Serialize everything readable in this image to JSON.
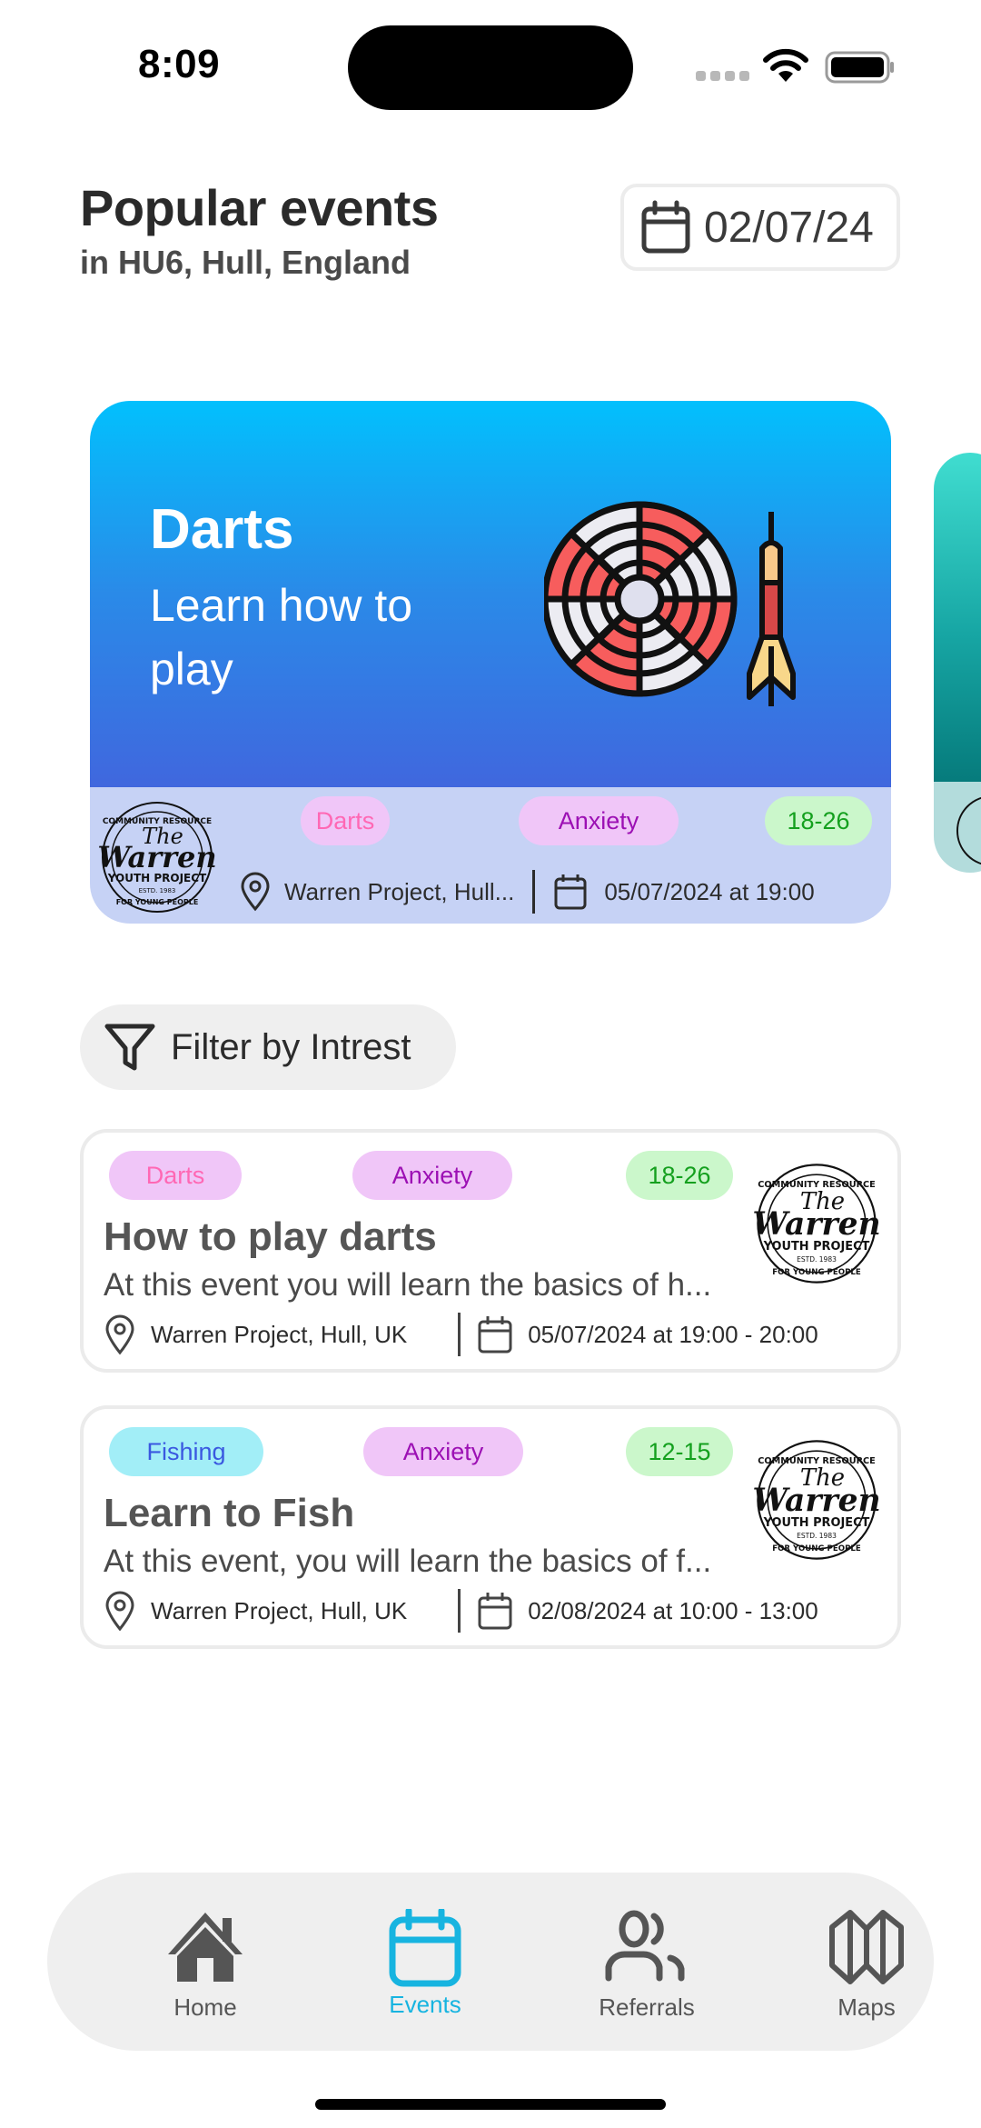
{
  "status_bar": {
    "time": "8:09"
  },
  "header": {
    "title": "Popular events",
    "subtitle": "in HU6, Hull, England",
    "date_picker": {
      "value": "02/07/24",
      "icon": "calendar-icon"
    }
  },
  "featured": [
    {
      "title": "Darts",
      "subtitle": "Learn how to play",
      "image": "dartboard-illustration",
      "gradient": [
        "#02c0fd",
        "#4067de"
      ],
      "organizer_logo": "The Warren Youth Project",
      "tags": [
        {
          "label": "Darts",
          "bg": "#f0c6f8",
          "color": "#ff68b4"
        },
        {
          "label": "Anxiety",
          "bg": "#f0c6f8",
          "color": "#9c10b4"
        },
        {
          "label": "18-26",
          "bg": "#cbf7cb",
          "color": "#14a01e"
        }
      ],
      "location": "Warren Project, Hull...",
      "datetime": "05/07/2024 at 19:00"
    },
    {
      "title": "",
      "gradient": [
        "#40ddd0",
        "#067b7c"
      ],
      "organizer_logo": "The Warren Youth Project"
    }
  ],
  "filter": {
    "label": "Filter by Intrest",
    "icon": "filter-icon"
  },
  "events": [
    {
      "title": "How to play darts",
      "description": "At this event you will learn the basics of h...",
      "tags": [
        {
          "label": "Darts",
          "bg": "#f0c6f8",
          "color": "#ff68b4"
        },
        {
          "label": "Anxiety",
          "bg": "#f0c6f8",
          "color": "#9c10b4"
        },
        {
          "label": "18-26",
          "bg": "#cbf7cb",
          "color": "#14a01e"
        }
      ],
      "location": "Warren Project, Hull, UK",
      "datetime": "05/07/2024 at 19:00 - 20:00",
      "organizer_logo": "The Warren Youth Project"
    },
    {
      "title": "Learn to Fish",
      "description": "At this event, you will learn the basics of f...",
      "tags": [
        {
          "label": "Fishing",
          "bg": "#a2eef7",
          "color": "#3a58e0"
        },
        {
          "label": "Anxiety",
          "bg": "#f0c6f8",
          "color": "#9c10b4"
        },
        {
          "label": "12-15",
          "bg": "#cbf7cb",
          "color": "#14a01e"
        }
      ],
      "location": "Warren Project, Hull, UK",
      "datetime": "02/08/2024 at 10:00 - 13:00",
      "organizer_logo": "The Warren Youth Project"
    }
  ],
  "logo_text": {
    "top": "COMMUNITY RESOURCE",
    "the": "The",
    "warren": "Warren",
    "youth": "YOUTH PROJECT",
    "estd": "ESTD. 1983",
    "bottom": "FOR YOUNG PEOPLE"
  },
  "bottom_nav": {
    "active": "Events",
    "accent": "#17b4e0",
    "items": [
      {
        "label": "Home",
        "icon": "home-icon"
      },
      {
        "label": "Events",
        "icon": "calendar-icon"
      },
      {
        "label": "Referrals",
        "icon": "users-icon"
      },
      {
        "label": "Maps",
        "icon": "map-icon"
      }
    ]
  }
}
